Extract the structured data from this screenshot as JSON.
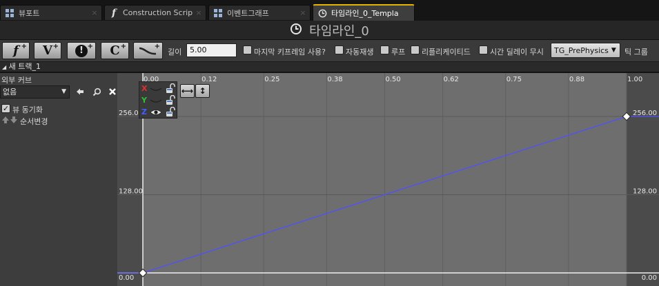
{
  "tabs": [
    {
      "label": "뷰포트",
      "icon": "viewport-grid-icon",
      "active": false
    },
    {
      "label": "Construction Scrip",
      "icon": "function-icon",
      "active": false
    },
    {
      "label": "이벤트그래프",
      "icon": "event-graph-grid-icon",
      "active": false
    },
    {
      "label": "타임라인_0_Templa",
      "icon": "clock-icon",
      "active": true
    }
  ],
  "tab_close_glyph": "×",
  "title": "타임라인_0",
  "toolbar": {
    "add_float_track": "f",
    "add_vector_track": "V",
    "add_event_track": "!",
    "add_color_track": "C",
    "plus_glyph": "+",
    "length_label": "길이",
    "length_value": "5.00",
    "use_last_keyframe_label": "마지막 키프레임 사용?",
    "use_last_keyframe": false,
    "autoplay_label": "자동재생",
    "autoplay": false,
    "loop_label": "루프",
    "loop": false,
    "replicated_label": "리플리케이티드",
    "replicated": false,
    "ignore_time_dilation_label": "시간 딜레이 무시",
    "ignore_time_dilation": false,
    "tick_group_value": "TG_PrePhysics",
    "tick_group_label": "틱 그룹"
  },
  "track": {
    "name": "새 트랙_1",
    "external_curve_label": "외부 커브",
    "external_curve_value": "없음",
    "sync_view_label": "뷰 동기화",
    "sync_view": true,
    "reorder_label": "순서변경"
  },
  "curve_channels": [
    {
      "letter": "X",
      "color": "#e03030"
    },
    {
      "letter": "Y",
      "color": "#30c030"
    },
    {
      "letter": "Z",
      "color": "#4060ff"
    }
  ],
  "chart_data": {
    "type": "line",
    "x_ticks": [
      "0.00",
      "0.12",
      "0.25",
      "0.38",
      "0.50",
      "0.62",
      "0.75",
      "0.88",
      "1.00"
    ],
    "y_ticks": [
      "256.00",
      "128.00",
      "0.00"
    ],
    "xlim": [
      0,
      1
    ],
    "ylim": [
      0,
      256
    ],
    "series": [
      {
        "x": [
          0,
          1
        ],
        "y": [
          0,
          256
        ],
        "color": "#5050ff"
      }
    ],
    "background": "#6e6e6e",
    "outside_background": "#4b4b4b"
  }
}
